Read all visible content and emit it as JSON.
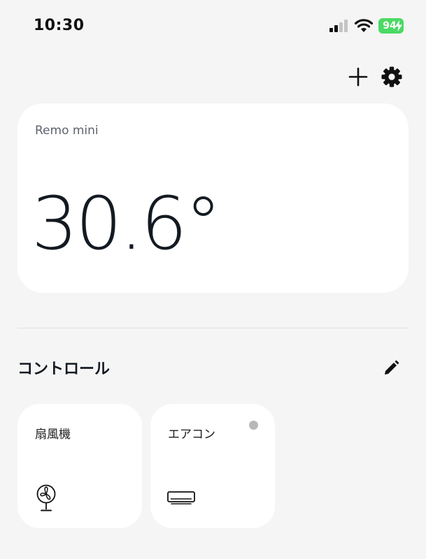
{
  "status_bar": {
    "time": "10:30",
    "battery_level": "94",
    "battery_color": "#4cd964",
    "icons": [
      "signal-icon",
      "wifi-icon",
      "battery-icon"
    ]
  },
  "toolbar": {
    "add_icon": "plus-icon",
    "settings_icon": "gear-icon"
  },
  "device": {
    "name": "Remo mini",
    "temperature": "30.6°"
  },
  "controls": {
    "title": "コントロール",
    "edit_icon": "pencil-icon",
    "items": [
      {
        "label": "扇風機",
        "icon": "fan-icon",
        "status_dot": false
      },
      {
        "label": "エアコン",
        "icon": "air-conditioner-icon",
        "status_dot": true,
        "status_color": "#b8b8b8"
      }
    ]
  }
}
